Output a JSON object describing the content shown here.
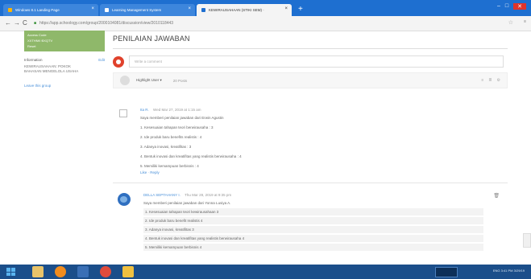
{
  "browser": {
    "tabs": [
      {
        "label": "Windows 8.1 Landing Page",
        "icon": "windows-tab-icon"
      },
      {
        "label": "Learning Management System",
        "icon": "schoology-tab-icon"
      },
      {
        "label": "KEWIRAUSAHAAN (STIKI SEM) ·",
        "icon": "schoology-tab-icon"
      }
    ],
    "new_tab": "+",
    "url": "https://app.schoology.com/group/2000104081/discussion/view/2010118443"
  },
  "sidebar": {
    "access_code_label": "Access Code",
    "access_code_value": "XXTHNK·BXQTV",
    "access_code_link": "Reset",
    "information_label": "Information",
    "edit_label": "Edit",
    "information_text": "KEWIRAUSAHAAN: POKOK BAHASAN MENGELOLA USAHA",
    "leave_label": "Leave this group"
  },
  "main": {
    "title": "PENILAIAN JAWABAN",
    "comment_placeholder": "Write a comment",
    "filter_label": "Highlight User ▾",
    "posts_count": "20 Posts",
    "posts": [
      {
        "author": "Ita R.",
        "time": "Wed Mar 27, 2019 at 1:15 am",
        "intro": "Saya memberi penilaian jawaban dari Erwin Agustin",
        "items": [
          "1. Kesesuaian tahapan teori berwirausaha : 3",
          "2. Ide produk baru benefits realistis : 4",
          "3. Adanya inovasi, kreatifitas : 3",
          "4. Bentuk inovasi dan kreatifitas yang realistis berwirausaha : 4",
          "5. Memiliki kemampuan berbisnis : 4"
        ],
        "actions": "Like · Reply"
      },
      {
        "author": "DELLA SEPTAHANY I.",
        "time": "Thu Mar 28, 2019 at 9:35 pm",
        "intro": "Saya memberi penilaian jawaban dari Yonna Lusiya A.",
        "items": [
          "1. Kesesuaian tahapan teori kewirausahaan 3",
          "2. Ide produk baru benefit realistis 4",
          "3. Adanya inovasi, kreatifitas 3",
          "4. Bentuk inovasi dan kreatifitas yang realistis berwirausaha 4",
          "5. Memiliki kemampuan berbisnis 4"
        ]
      }
    ]
  },
  "taskbar": {
    "tray_lang": "ENG",
    "clock_time": "3:41 PM",
    "clock_date": "3/29/19"
  },
  "colors": {
    "tab_strip": "#1e6fd0",
    "taskbar": "#1b4e8a",
    "link": "#4a90d9",
    "access_green": "#8fb86a"
  }
}
